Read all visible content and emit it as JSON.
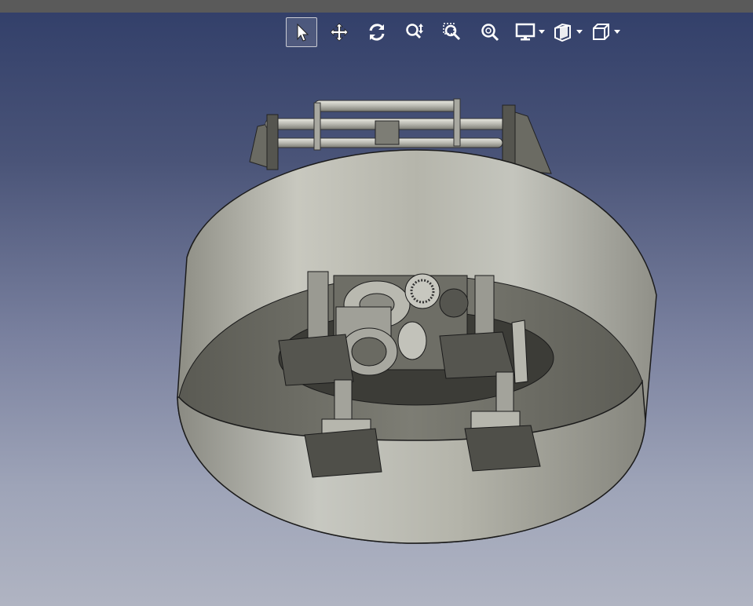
{
  "toolbar": {
    "tools": [
      {
        "name": "select-tool",
        "icon": "pointer-arrow-icon",
        "active": true
      },
      {
        "name": "pan-tool",
        "icon": "move-cross-arrows-icon"
      },
      {
        "name": "rotate-tool",
        "icon": "rotate-circle-arrows-icon"
      },
      {
        "name": "zoom-tool",
        "icon": "zoom-updown-icon"
      },
      {
        "name": "zoom-box-tool",
        "icon": "zoom-box-icon"
      },
      {
        "name": "zoom-fit-tool",
        "icon": "zoom-fit-icon"
      },
      {
        "name": "display-mode-dropdown",
        "icon": "monitor-icon",
        "dropdown": true
      },
      {
        "name": "section-view-dropdown",
        "icon": "clipping-plane-icon",
        "dropdown": true
      },
      {
        "name": "standard-views-dropdown",
        "icon": "cube-view-icon",
        "dropdown": true
      }
    ]
  },
  "colors": {
    "bg_top": "#33406a",
    "bg_bottom": "#b0b4c2",
    "model_shell": "#a9a99f",
    "model_dark": "#4d4d46",
    "toolbar_icon": "#ffffff"
  }
}
